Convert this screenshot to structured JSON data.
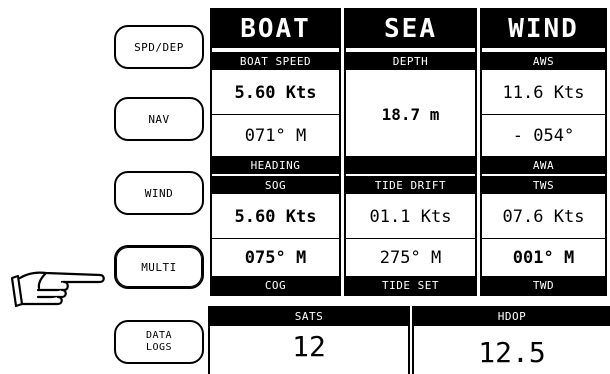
{
  "softkeys": [
    {
      "label": "SPD/DEP"
    },
    {
      "label": "NAV"
    },
    {
      "label": "WIND"
    },
    {
      "label": "MULTI"
    },
    {
      "label": "DATA\nLOGS"
    }
  ],
  "active_softkey": "MULTI",
  "boat": {
    "title": "BOAT",
    "speed_label": "BOAT SPEED",
    "speed_value": "5.60 Kts",
    "heading_value": "071° M",
    "heading_label": "HEADING",
    "sog_label": "SOG",
    "sog_value": "5.60 Kts",
    "cog_value": "075° M",
    "cog_label": "COG"
  },
  "sea": {
    "title": "SEA",
    "depth_label": "DEPTH",
    "depth_value": "18.7 m",
    "drift_label": "TIDE DRIFT",
    "drift_value": "01.1 Kts",
    "set_value": "275° M",
    "set_label": "TIDE SET"
  },
  "wind": {
    "title": "WIND",
    "aws_label": "AWS",
    "aws_value": "11.6 Kts",
    "awa_value": "- 054°",
    "awa_label": "AWA",
    "tws_label": "TWS",
    "tws_value": "07.6 Kts",
    "twd_value": "001° M",
    "twd_label": "TWD"
  },
  "gps": {
    "sats_label": "SATS",
    "sats_value": "12",
    "hdop_label": "HDOP",
    "hdop_value": "12.5"
  }
}
